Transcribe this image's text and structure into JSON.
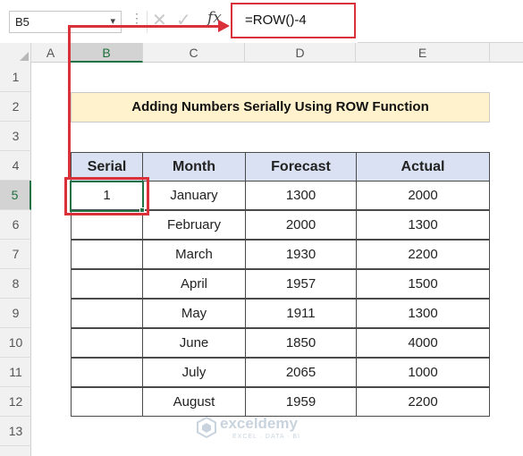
{
  "formula_bar": {
    "name_box": "B5",
    "name_box_arrow": "▾",
    "dots": "⋮",
    "cancel": "✕",
    "enter": "✓",
    "fx": "fx",
    "formula": "=ROW()-4"
  },
  "columns": [
    "A",
    "B",
    "C",
    "D",
    "E"
  ],
  "rows": [
    "1",
    "2",
    "3",
    "4",
    "5",
    "6",
    "7",
    "8",
    "9",
    "10",
    "11",
    "12",
    "13"
  ],
  "selected_column": "B",
  "selected_row": "5",
  "title": "Adding Numbers Serially Using ROW Function",
  "table": {
    "headers": [
      "Serial",
      "Month",
      "Forecast",
      "Actual"
    ],
    "rows": [
      [
        "1",
        "January",
        "1300",
        "2000"
      ],
      [
        "",
        "February",
        "2000",
        "1300"
      ],
      [
        "",
        "March",
        "1930",
        "2200"
      ],
      [
        "",
        "April",
        "1957",
        "1500"
      ],
      [
        "",
        "May",
        "1911",
        "1300"
      ],
      [
        "",
        "June",
        "1850",
        "4000"
      ],
      [
        "",
        "July",
        "2065",
        "1000"
      ],
      [
        "",
        "August",
        "1959",
        "2200"
      ]
    ]
  },
  "watermark": {
    "name": "exceldemy",
    "tagline": "EXCEL · DATA · BI"
  },
  "colors": {
    "highlight_red": "#d9303a",
    "excel_green": "#217346",
    "title_fill": "#fff2cc",
    "header_fill": "#d9e1f2"
  }
}
